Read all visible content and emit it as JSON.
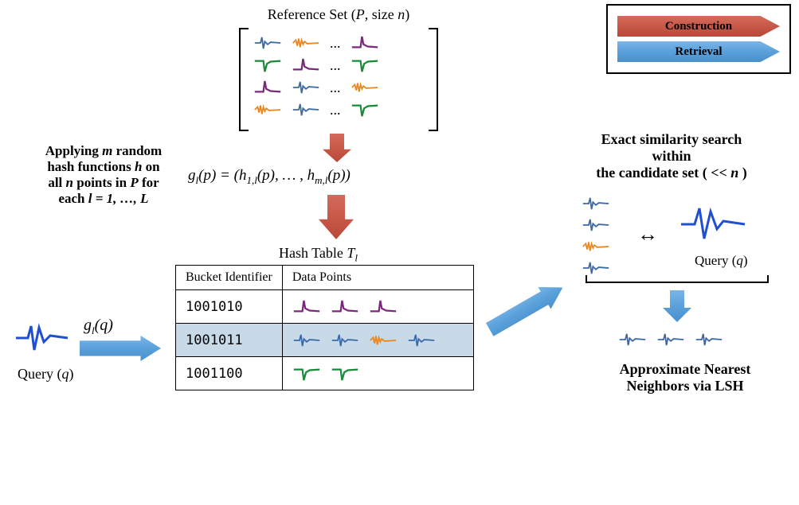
{
  "legend": {
    "construction": "Construction",
    "retrieval": "Retrieval"
  },
  "ref_title": "Reference Set (P, size n)",
  "ellipsis": "...",
  "left_text_line1": "Applying m random",
  "left_text_line2": "hash functions h on",
  "left_text_line3": "all n points in P for",
  "left_text_line4": "each l = 1, …, L",
  "formula": "gₗ(p) = (h₁,ₗ(p), …, h_{m,l}(p))",
  "formula_left": "g",
  "formula_sub_l": "l",
  "formula_paren1": "(",
  "formula_p": "p",
  "formula_paren2": ") = (",
  "formula_h": "h",
  "formula_sub_1l": "1,l",
  "formula_p2": "(p), … , ",
  "formula_h2": "h",
  "formula_sub_ml": "m,l",
  "formula_p3": "(p))",
  "table_title": "Hash Table Tₗ",
  "table_title_main": "Hash Table ",
  "table_title_T": "T",
  "table_title_sub": "l",
  "th_bucket": "Bucket Identifier",
  "th_data": "Data Points",
  "bucket1": "1001010",
  "bucket2": "1001011",
  "bucket3": "1001100",
  "query_label": "Query (q)",
  "q_formula_g": "g",
  "q_formula_l": "l",
  "q_formula_q": "(q)",
  "right_text_line1": "Exact similarity search",
  "right_text_line2": "within",
  "right_text_line3": "the candidate set ( << n )",
  "query_right_label": "Query (q)",
  "result_label_line1": "Approximate Nearest",
  "result_label_line2": "Neighbors via LSH",
  "colors": {
    "blue": "#3c6aa8",
    "blue_bright": "#2050d0",
    "green": "#1a8a3a",
    "purple": "#7a2a7a",
    "orange": "#e88820"
  }
}
